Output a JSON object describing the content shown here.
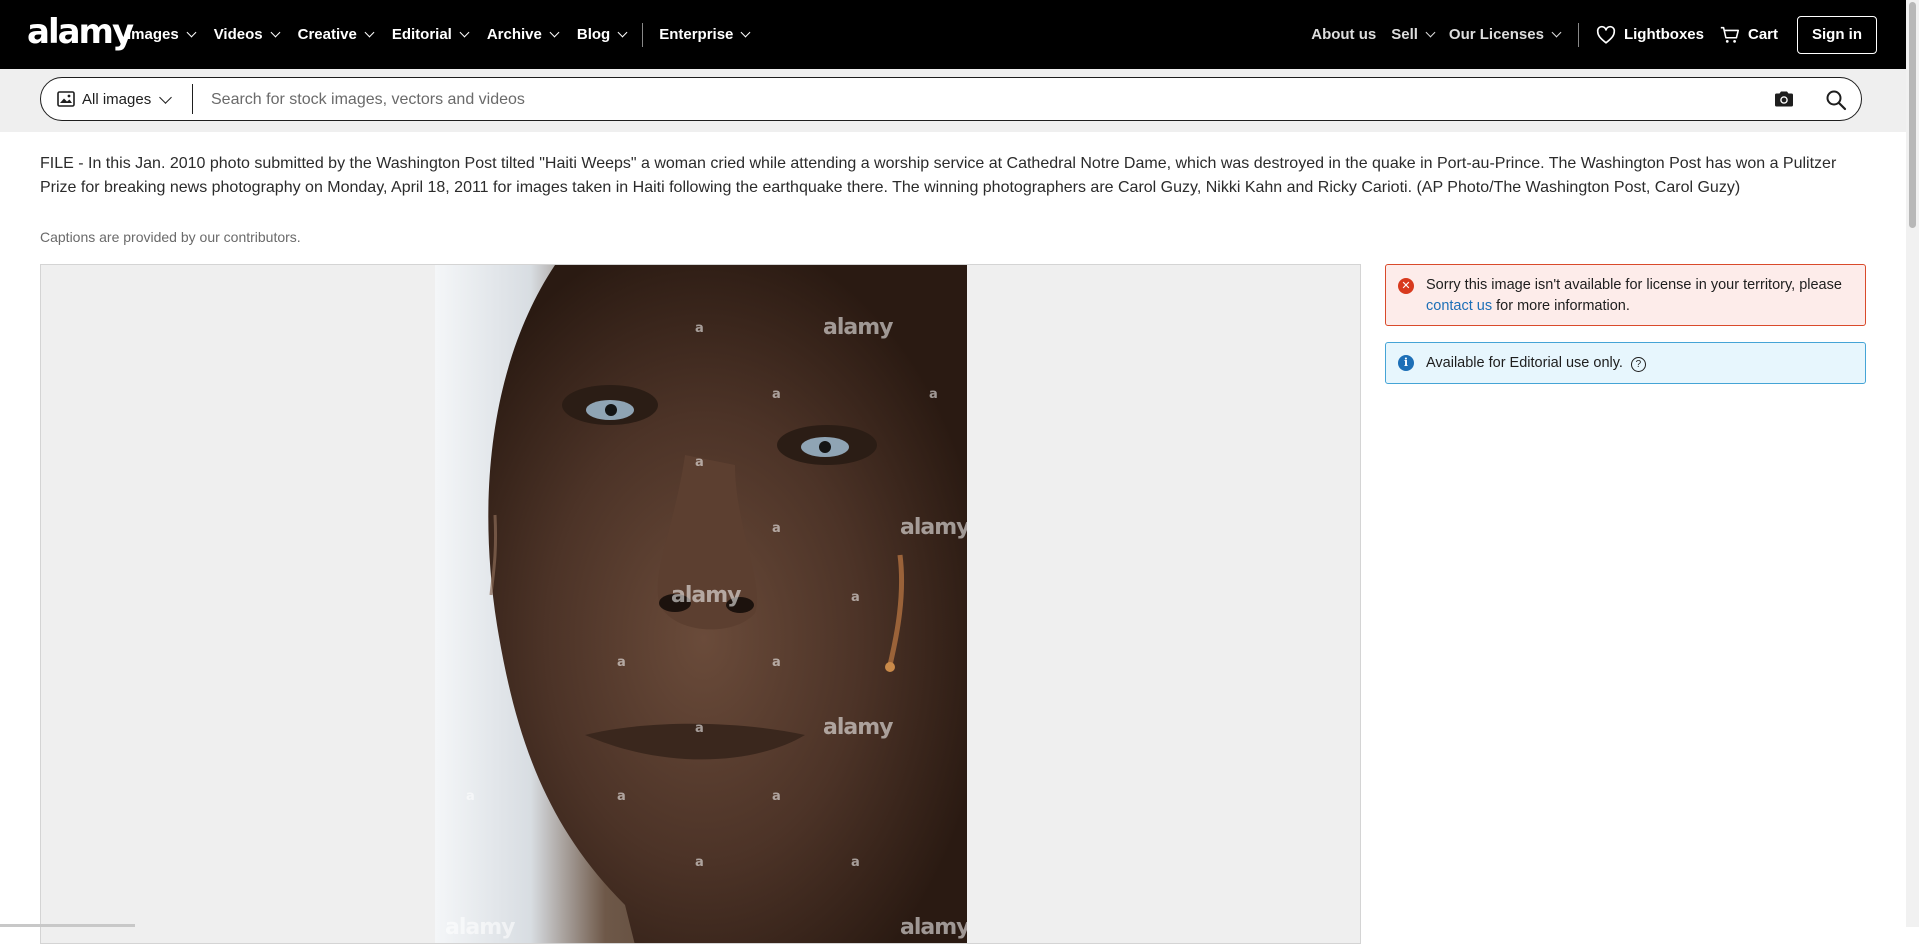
{
  "brand": {
    "logo_text": "alamy"
  },
  "nav": {
    "left_items": [
      "Images",
      "Videos",
      "Creative",
      "Editorial",
      "Archive",
      "Blog"
    ],
    "enterprise": "Enterprise",
    "about": "About us",
    "sell": "Sell",
    "licenses": "Our Licenses",
    "lightboxes": "Lightboxes",
    "cart": "Cart",
    "signin": "Sign in"
  },
  "search": {
    "scope_label": "All images",
    "placeholder": "Search for stock images, vectors and videos",
    "value": ""
  },
  "caption": {
    "text": "FILE - In this Jan. 2010 photo submitted by the Washington Post tilted \"Haiti Weeps\" a woman cried while attending a worship service at Cathedral Notre Dame, which was destroyed in the quake in Port-au-Prince. The Washington Post has won a Pulitzer Prize for breaking news photography on Monday, April 18, 2011 for images taken in Haiti following the earthquake there. The winning photographers are Carol Guzy, Nikki Kahn and Ricky Carioti. (AP Photo/The Washington Post, Carol Guzy)",
    "note": "Captions are provided by our contributors."
  },
  "image": {
    "watermark": "alamy",
    "watermark_small": "a"
  },
  "notices": {
    "error_before": "Sorry this image isn't available for license in your territory, please ",
    "error_link": "contact us",
    "error_after": " for more information.",
    "info": "Available for Editorial use only.",
    "colors": {
      "error_bg": "#fdecea",
      "error_border": "#d94a2b",
      "info_bg": "#e7f6fd",
      "info_border": "#45a4d6",
      "link": "#1d6fb7"
    }
  },
  "icons": [
    "image-icon",
    "camera-icon",
    "search-icon",
    "heart-icon",
    "cart-icon",
    "error-icon",
    "info-icon",
    "help-icon",
    "chevron-down-icon"
  ]
}
